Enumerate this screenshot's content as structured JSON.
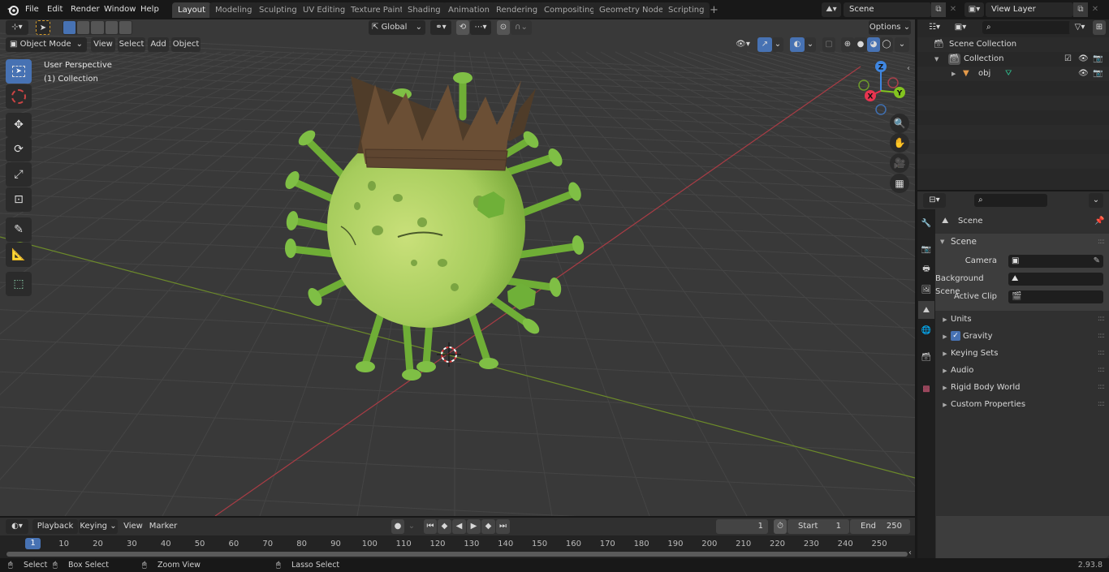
{
  "topbar": {
    "menus": [
      "File",
      "Edit",
      "Render",
      "Window",
      "Help"
    ],
    "workspaces": [
      {
        "label": "Layout",
        "active": true
      },
      {
        "label": "Modeling"
      },
      {
        "label": "Sculpting"
      },
      {
        "label": "UV Editing"
      },
      {
        "label": "Texture Paint"
      },
      {
        "label": "Shading"
      },
      {
        "label": "Animation"
      },
      {
        "label": "Rendering"
      },
      {
        "label": "Compositing"
      },
      {
        "label": "Geometry Nodes"
      },
      {
        "label": "Scripting"
      }
    ],
    "add_workspace": "+",
    "scene_name": "Scene",
    "view_layer": "View Layer"
  },
  "viewport": {
    "mode": "Object Mode",
    "menus": [
      "View",
      "Select",
      "Add",
      "Object"
    ],
    "transform_orientation": "Global",
    "options_label": "Options",
    "overlay_title": "User Perspective",
    "overlay_collection": "(1) Collection",
    "gizmo_axes": {
      "x": "X",
      "y": "Y",
      "z": "Z"
    },
    "colors": {
      "x_axis": "#e8344f",
      "y_axis": "#83c41f",
      "z_axis": "#3f86e0",
      "active_tool": "#4772b3",
      "crown": "#6b4f35",
      "virus_body": "#a6cc5c"
    },
    "tools": [
      "select-box",
      "cursor",
      "move",
      "rotate",
      "scale",
      "transform",
      "annotate",
      "measure",
      "add-cube"
    ]
  },
  "outliner": {
    "root": "Scene Collection",
    "items": [
      {
        "label": "Collection",
        "type": "collection"
      },
      {
        "label": "obj",
        "type": "mesh"
      }
    ]
  },
  "properties": {
    "context": "Scene",
    "panel_title": "Scene",
    "fields": [
      {
        "label": "Camera",
        "value": ""
      },
      {
        "label": "Background Scene",
        "value": ""
      },
      {
        "label": "Active Clip",
        "value": ""
      }
    ],
    "subpanels": [
      {
        "label": "Units"
      },
      {
        "label": "Gravity",
        "checkbox": true,
        "checked": true
      },
      {
        "label": "Keying Sets"
      },
      {
        "label": "Audio"
      },
      {
        "label": "Rigid Body World"
      },
      {
        "label": "Custom Properties"
      }
    ]
  },
  "timeline": {
    "menus": [
      "Playback",
      "Keying",
      "View",
      "Marker"
    ],
    "current_frame": "1",
    "start_label": "Start",
    "start": "1",
    "end_label": "End",
    "end": "250",
    "playhead": "1",
    "ticks": [
      "10",
      "20",
      "30",
      "40",
      "50",
      "60",
      "70",
      "80",
      "90",
      "100",
      "110",
      "120",
      "130",
      "140",
      "150",
      "160",
      "170",
      "180",
      "190",
      "200",
      "210",
      "220",
      "230",
      "240",
      "250"
    ]
  },
  "statusbar": {
    "hints": [
      "Select",
      "Box Select",
      "Zoom View",
      "Lasso Select"
    ],
    "version": "2.93.8"
  }
}
